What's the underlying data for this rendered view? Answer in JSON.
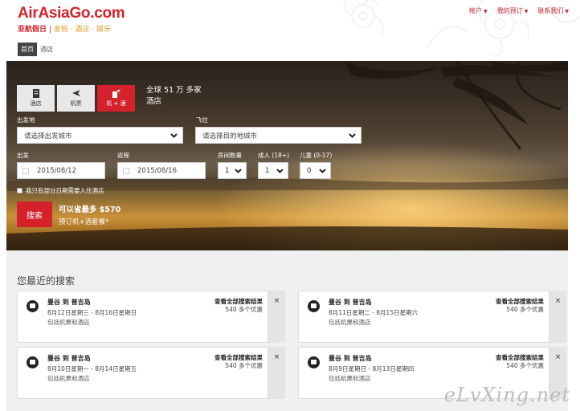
{
  "header": {
    "logo_main": "AirAsia",
    "logo_go": "Go",
    "logo_tld": ".com",
    "logo_sub_brand": "亚航假日",
    "logo_slogan": "度假 · 酒店 · 娱乐",
    "nav": [
      {
        "label": "帐户"
      },
      {
        "label": "我的预订"
      },
      {
        "label": "联系我们"
      }
    ]
  },
  "breadcrumb": {
    "home": "首页",
    "current": "酒店"
  },
  "search": {
    "tabs": [
      {
        "label": "酒店",
        "icon": "hotel-icon",
        "active": false
      },
      {
        "label": "机票",
        "icon": "plane-icon",
        "active": false
      },
      {
        "label": "机 + 酒",
        "icon": "flight-hotel-icon",
        "active": true
      }
    ],
    "hotel_count": "全球 51 万 多家酒店",
    "origin_label": "出发地",
    "origin_placeholder": "请选择出发城市",
    "destination_label": "飞往",
    "destination_placeholder": "请选择目的地城市",
    "depart_label": "出发",
    "depart_value": "2015/08/12",
    "return_label": "返程",
    "return_value": "2015/08/16",
    "rooms_label": "房间数量",
    "rooms_value": "1",
    "adults_label": "成人 (18+)",
    "adults_value": "1",
    "children_label": "儿童 (0-17)",
    "children_value": "0",
    "partial_stay_label": "我只有部分日期需要入住酒店",
    "search_button": "搜索",
    "promo_line1": "可以省最多 $570",
    "promo_line2": "预订机+酒套餐*"
  },
  "recent": {
    "title": "您最近的搜索",
    "cards": [
      {
        "route": "曼谷 到 普吉岛",
        "dates": "8月12日星期三 - 8月16日星期日",
        "includes": "包括机票和酒店",
        "view_all": "查看全部搜索结果",
        "count": "540 多个优惠",
        "close": "×"
      },
      {
        "route": "曼谷 到 普吉岛",
        "dates": "8月11日星期二 - 8月15日星期六",
        "includes": "包括机票和酒店",
        "view_all": "查看全部搜索结果",
        "count": "540 多个优惠",
        "close": "×"
      },
      {
        "route": "曼谷 到 普吉岛",
        "dates": "8月10日星期一 - 8月14日星期五",
        "includes": "包括机票和酒店",
        "view_all": "查看全部搜索结果",
        "count": "540 多个优惠",
        "close": "×"
      },
      {
        "route": "曼谷 到 普吉岛",
        "dates": "8月9日星期日 - 8月13日星期四",
        "includes": "包括机票和酒店",
        "view_all": "查看全部搜索结果",
        "count": "540 多个优惠",
        "close": "×"
      }
    ]
  },
  "watermark": "eLvXing.net",
  "colors": {
    "brand_red": "#d4212c",
    "slogan_gold": "#e0a030"
  }
}
